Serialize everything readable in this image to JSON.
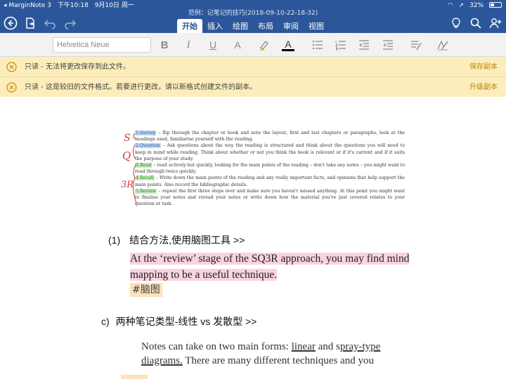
{
  "status_bar": {
    "app": "◂ MarginNote 3",
    "time": "下午10:18",
    "date": "9月10日 周一",
    "battery": "32%"
  },
  "document": {
    "title": "范例：记笔记的技巧(2018-09-10-22-18-32)"
  },
  "tabs": [
    "开始",
    "插入",
    "绘图",
    "布局",
    "审阅",
    "视图"
  ],
  "toolbar": {
    "font_name": "Helvetica Neue",
    "bold": "B",
    "italic": "I",
    "underline": "U",
    "font_size": "A",
    "font_color": "A"
  },
  "banners": [
    {
      "message": "只读 - 无法将更改保存到此文件。",
      "action": "保存副本"
    },
    {
      "message": "只读 - 这是较旧的文件格式。若要进行更改，请以新格式创建文件的副本。",
      "action": "升级副本"
    }
  ],
  "scan": {
    "steps": [
      {
        "label": "1.Survey",
        "text": " – flip through the chapter or book and note the layout, first and last chapters or paragraphs, look at the headings used, familiarise yourself with the reading."
      },
      {
        "label": "2.Question",
        "text": " – Ask questions about the way the reading is structured and think about the questions you will need to keep in mind while reading. Think about whether or not you think the book is relevant or if it's current and if it suits the purpose of your study."
      },
      {
        "label": "3.Read",
        "text": " – read actively but quickly, looking for the main points of the reading – don't take any notes – you might want to read through twice quickly."
      },
      {
        "label": "4.Recall",
        "text": " – Write down the main points of the reading and any really important facts, and opinions that help support the main points. Also record the bibliographic details."
      },
      {
        "label": "5.Review",
        "text": " – repeat the first three steps over and make sure you haven't missed anything. At this point you might want to finalise your notes and reread your notes or write down how the material you've just covered relates to your question or task."
      }
    ],
    "handwriting": [
      "S",
      "Q",
      "3R"
    ]
  },
  "item1": {
    "number": "(1)",
    "label": "结合方法,使用脑图工具 >>",
    "quote": "At the ‘review’ stage of the SQ3R approach, you may find mind mapping to be a useful technique.",
    "tag": "#脑图"
  },
  "item2": {
    "number": "c)",
    "label": "两种笔记类型-线性 vs 发散型 >>"
  },
  "notes": {
    "part1": "Notes can take on two main forms: ",
    "linear": "linear",
    "and": " and s",
    "spray": "pray-type diagrams.",
    "part2": " There are many different techniques and you"
  },
  "colors": {
    "ribbon": "#2b579a",
    "banner": "#fcedbb",
    "quote_highlight": "#f9d3df",
    "tag_highlight": "#fbe2b8",
    "handwriting": "#d43a3a"
  }
}
